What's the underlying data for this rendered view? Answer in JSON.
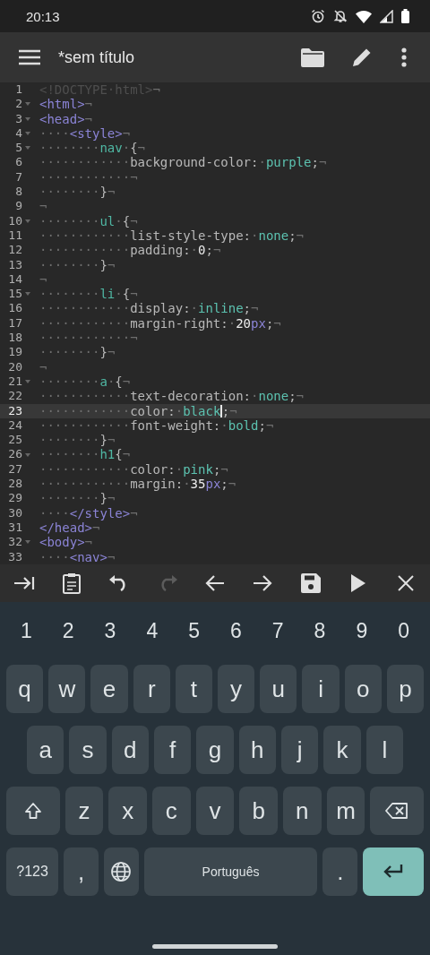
{
  "status_bar": {
    "time": "20:13"
  },
  "app_bar": {
    "title": "*sem título"
  },
  "editor": {
    "lines": [
      {
        "n": "1",
        "fold": false,
        "current": false,
        "tokens": [
          {
            "kind": "doctype",
            "text": "<!DOCTYPE·html>"
          },
          {
            "kind": "space",
            "text": "¬"
          }
        ]
      },
      {
        "n": "2",
        "fold": true,
        "current": false,
        "tokens": [
          {
            "kind": "tag",
            "text": "<html>"
          },
          {
            "kind": "space",
            "text": "¬"
          }
        ]
      },
      {
        "n": "3",
        "fold": true,
        "current": false,
        "tokens": [
          {
            "kind": "tag",
            "text": "<head>"
          },
          {
            "kind": "space",
            "text": "¬"
          }
        ]
      },
      {
        "n": "4",
        "fold": true,
        "current": false,
        "tokens": [
          {
            "kind": "space",
            "text": "····"
          },
          {
            "kind": "tag",
            "text": "<style>"
          },
          {
            "kind": "space",
            "text": "¬"
          }
        ]
      },
      {
        "n": "5",
        "fold": true,
        "current": false,
        "tokens": [
          {
            "kind": "space",
            "text": "········"
          },
          {
            "kind": "selector",
            "text": "nav"
          },
          {
            "kind": "space",
            "text": "·"
          },
          {
            "kind": "punct",
            "text": "{"
          },
          {
            "kind": "space",
            "text": "¬"
          }
        ]
      },
      {
        "n": "6",
        "fold": false,
        "current": false,
        "tokens": [
          {
            "kind": "space",
            "text": "············"
          },
          {
            "kind": "punct",
            "text": "background-color:"
          },
          {
            "kind": "space",
            "text": "·"
          },
          {
            "kind": "value",
            "text": "purple"
          },
          {
            "kind": "punct",
            "text": ";"
          },
          {
            "kind": "space",
            "text": "¬"
          }
        ]
      },
      {
        "n": "7",
        "fold": false,
        "current": false,
        "tokens": [
          {
            "kind": "space",
            "text": "············¬"
          }
        ]
      },
      {
        "n": "8",
        "fold": false,
        "current": false,
        "tokens": [
          {
            "kind": "space",
            "text": "········"
          },
          {
            "kind": "punct",
            "text": "}"
          },
          {
            "kind": "space",
            "text": "¬"
          }
        ]
      },
      {
        "n": "9",
        "fold": false,
        "current": false,
        "tokens": [
          {
            "kind": "space",
            "text": "¬"
          }
        ]
      },
      {
        "n": "10",
        "fold": true,
        "current": false,
        "tokens": [
          {
            "kind": "space",
            "text": "········"
          },
          {
            "kind": "selector",
            "text": "ul"
          },
          {
            "kind": "space",
            "text": "·"
          },
          {
            "kind": "punct",
            "text": "{"
          },
          {
            "kind": "space",
            "text": "¬"
          }
        ]
      },
      {
        "n": "11",
        "fold": false,
        "current": false,
        "tokens": [
          {
            "kind": "space",
            "text": "············"
          },
          {
            "kind": "punct",
            "text": "list-style-type:"
          },
          {
            "kind": "space",
            "text": "·"
          },
          {
            "kind": "value",
            "text": "none"
          },
          {
            "kind": "punct",
            "text": ";"
          },
          {
            "kind": "space",
            "text": "¬"
          }
        ]
      },
      {
        "n": "12",
        "fold": false,
        "current": false,
        "tokens": [
          {
            "kind": "space",
            "text": "············"
          },
          {
            "kind": "punct",
            "text": "padding:"
          },
          {
            "kind": "space",
            "text": "·"
          },
          {
            "kind": "number",
            "text": "0"
          },
          {
            "kind": "punct",
            "text": ";"
          },
          {
            "kind": "space",
            "text": "¬"
          }
        ]
      },
      {
        "n": "13",
        "fold": false,
        "current": false,
        "tokens": [
          {
            "kind": "space",
            "text": "········"
          },
          {
            "kind": "punct",
            "text": "}"
          },
          {
            "kind": "space",
            "text": "¬"
          }
        ]
      },
      {
        "n": "14",
        "fold": false,
        "current": false,
        "tokens": [
          {
            "kind": "space",
            "text": "¬"
          }
        ]
      },
      {
        "n": "15",
        "fold": true,
        "current": false,
        "tokens": [
          {
            "kind": "space",
            "text": "········"
          },
          {
            "kind": "selector",
            "text": "li"
          },
          {
            "kind": "space",
            "text": "·"
          },
          {
            "kind": "punct",
            "text": "{"
          },
          {
            "kind": "space",
            "text": "¬"
          }
        ]
      },
      {
        "n": "16",
        "fold": false,
        "current": false,
        "tokens": [
          {
            "kind": "space",
            "text": "············"
          },
          {
            "kind": "punct",
            "text": "display:"
          },
          {
            "kind": "space",
            "text": "·"
          },
          {
            "kind": "value",
            "text": "inline"
          },
          {
            "kind": "punct",
            "text": ";"
          },
          {
            "kind": "space",
            "text": "¬"
          }
        ]
      },
      {
        "n": "17",
        "fold": false,
        "current": false,
        "tokens": [
          {
            "kind": "space",
            "text": "············"
          },
          {
            "kind": "punct",
            "text": "margin-right:"
          },
          {
            "kind": "space",
            "text": "·"
          },
          {
            "kind": "number",
            "text": "20"
          },
          {
            "kind": "unit",
            "text": "px"
          },
          {
            "kind": "punct",
            "text": ";"
          },
          {
            "kind": "space",
            "text": "¬"
          }
        ]
      },
      {
        "n": "18",
        "fold": false,
        "current": false,
        "tokens": [
          {
            "kind": "space",
            "text": "············¬"
          }
        ]
      },
      {
        "n": "19",
        "fold": false,
        "current": false,
        "tokens": [
          {
            "kind": "space",
            "text": "········"
          },
          {
            "kind": "punct",
            "text": "}"
          },
          {
            "kind": "space",
            "text": "¬"
          }
        ]
      },
      {
        "n": "20",
        "fold": false,
        "current": false,
        "tokens": [
          {
            "kind": "space",
            "text": "¬"
          }
        ]
      },
      {
        "n": "21",
        "fold": true,
        "current": false,
        "tokens": [
          {
            "kind": "space",
            "text": "········"
          },
          {
            "kind": "selector",
            "text": "a"
          },
          {
            "kind": "space",
            "text": "·"
          },
          {
            "kind": "punct",
            "text": "{"
          },
          {
            "kind": "space",
            "text": "¬"
          }
        ]
      },
      {
        "n": "22",
        "fold": false,
        "current": false,
        "tokens": [
          {
            "kind": "space",
            "text": "············"
          },
          {
            "kind": "punct",
            "text": "text-decoration:"
          },
          {
            "kind": "space",
            "text": "·"
          },
          {
            "kind": "value",
            "text": "none"
          },
          {
            "kind": "punct",
            "text": ";"
          },
          {
            "kind": "space",
            "text": "¬"
          }
        ]
      },
      {
        "n": "23",
        "fold": false,
        "current": true,
        "tokens": [
          {
            "kind": "space",
            "text": "············"
          },
          {
            "kind": "punct",
            "text": "color:"
          },
          {
            "kind": "space",
            "text": "·"
          },
          {
            "kind": "value",
            "text": "black",
            "caret": true
          },
          {
            "kind": "punct",
            "text": ";"
          },
          {
            "kind": "space",
            "text": "¬"
          }
        ]
      },
      {
        "n": "24",
        "fold": false,
        "current": false,
        "tokens": [
          {
            "kind": "space",
            "text": "············"
          },
          {
            "kind": "punct",
            "text": "font-weight:"
          },
          {
            "kind": "space",
            "text": "·"
          },
          {
            "kind": "value",
            "text": "bold"
          },
          {
            "kind": "punct",
            "text": ";"
          },
          {
            "kind": "space",
            "text": "¬"
          }
        ]
      },
      {
        "n": "25",
        "fold": false,
        "current": false,
        "tokens": [
          {
            "kind": "space",
            "text": "········"
          },
          {
            "kind": "punct",
            "text": "}"
          },
          {
            "kind": "space",
            "text": "¬"
          }
        ]
      },
      {
        "n": "26",
        "fold": true,
        "current": false,
        "tokens": [
          {
            "kind": "space",
            "text": "········"
          },
          {
            "kind": "selector",
            "text": "h1"
          },
          {
            "kind": "punct",
            "text": "{"
          },
          {
            "kind": "space",
            "text": "¬"
          }
        ]
      },
      {
        "n": "27",
        "fold": false,
        "current": false,
        "tokens": [
          {
            "kind": "space",
            "text": "············"
          },
          {
            "kind": "punct",
            "text": "color:"
          },
          {
            "kind": "space",
            "text": "·"
          },
          {
            "kind": "value",
            "text": "pink"
          },
          {
            "kind": "punct",
            "text": ";"
          },
          {
            "kind": "space",
            "text": "¬"
          }
        ]
      },
      {
        "n": "28",
        "fold": false,
        "current": false,
        "tokens": [
          {
            "kind": "space",
            "text": "············"
          },
          {
            "kind": "punct",
            "text": "margin:"
          },
          {
            "kind": "space",
            "text": "·"
          },
          {
            "kind": "number",
            "text": "35"
          },
          {
            "kind": "unit",
            "text": "px"
          },
          {
            "kind": "punct",
            "text": ";"
          },
          {
            "kind": "space",
            "text": "¬"
          }
        ]
      },
      {
        "n": "29",
        "fold": false,
        "current": false,
        "tokens": [
          {
            "kind": "space",
            "text": "········"
          },
          {
            "kind": "punct",
            "text": "}"
          },
          {
            "kind": "space",
            "text": "¬"
          }
        ]
      },
      {
        "n": "30",
        "fold": false,
        "current": false,
        "tokens": [
          {
            "kind": "space",
            "text": "····"
          },
          {
            "kind": "tag",
            "text": "</style>"
          },
          {
            "kind": "space",
            "text": "¬"
          }
        ]
      },
      {
        "n": "31",
        "fold": false,
        "current": false,
        "tokens": [
          {
            "kind": "tag",
            "text": "</head>"
          },
          {
            "kind": "space",
            "text": "¬"
          }
        ]
      },
      {
        "n": "32",
        "fold": true,
        "current": false,
        "tokens": [
          {
            "kind": "tag",
            "text": "<body>"
          },
          {
            "kind": "space",
            "text": "¬"
          }
        ]
      },
      {
        "n": "33",
        "fold": false,
        "current": false,
        "tokens": [
          {
            "kind": "space",
            "text": "····"
          },
          {
            "kind": "tag",
            "text": "<nav>"
          },
          {
            "kind": "space",
            "text": "¬"
          }
        ]
      }
    ]
  },
  "toolbar": [
    {
      "kind": "tab",
      "disabled": false
    },
    {
      "kind": "clipboard",
      "disabled": false
    },
    {
      "kind": "undo",
      "disabled": false
    },
    {
      "kind": "redo",
      "disabled": true
    },
    {
      "kind": "left",
      "disabled": false
    },
    {
      "kind": "right",
      "disabled": false
    },
    {
      "kind": "save",
      "disabled": false
    },
    {
      "kind": "run",
      "disabled": false
    },
    {
      "kind": "close",
      "disabled": false
    }
  ],
  "keyboard": {
    "number_row": [
      "1",
      "2",
      "3",
      "4",
      "5",
      "6",
      "7",
      "8",
      "9",
      "0"
    ],
    "rows": [
      [
        "q",
        "w",
        "e",
        "r",
        "t",
        "y",
        "u",
        "i",
        "o",
        "p"
      ],
      [
        "a",
        "s",
        "d",
        "f",
        "g",
        "h",
        "j",
        "k",
        "l"
      ],
      [
        "z",
        "x",
        "c",
        "v",
        "b",
        "n",
        "m"
      ]
    ],
    "symbols_key": "?123",
    "comma_key": ",",
    "space_key": "Português",
    "period_key": "."
  }
}
